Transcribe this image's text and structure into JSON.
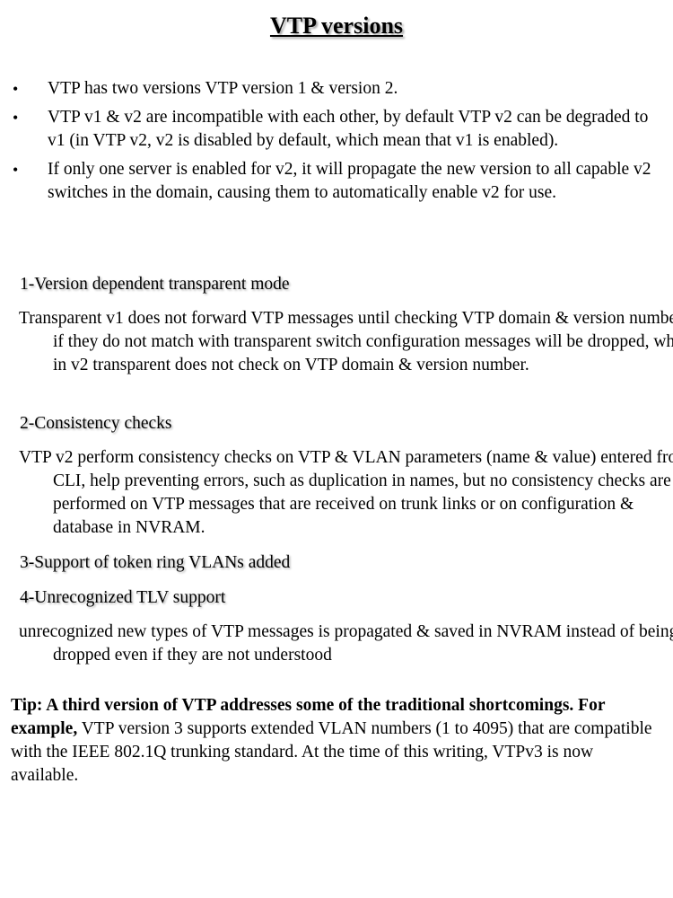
{
  "title": "VTP versions",
  "bullets": [
    "VTP has two versions VTP version 1 & version 2.",
    "VTP v1 & v2 are incompatible with each other, by default VTP v2 can be degraded to v1 (in VTP v2, v2 is disabled by default, which mean that v1 is enabled).",
    "If only one server is enabled for v2, it will propagate the new version to all capable v2 switches in the domain, causing them to automatically enable v2 for use."
  ],
  "bullet_glyph": "•",
  "sections": [
    {
      "heading": "1-Version dependent transparent mode",
      "body": "Transparent v1 does not forward VTP messages until checking VTP domain & version number, if they do not match with transparent switch configuration messages will be dropped, while in v2 transparent does not check on VTP domain & version number."
    },
    {
      "heading": "2-Consistency checks",
      "body": "VTP v2 perform consistency checks on VTP & VLAN parameters (name & value) entered from CLI, help preventing errors, such as duplication in names, but no consistency checks are performed on VTP messages that are received on trunk links or on configuration & database in NVRAM."
    },
    {
      "heading": "3-Support of token ring VLANs added"
    },
    {
      "heading": "4-Unrecognized TLV support",
      "body": "unrecognized new types of VTP messages is propagated & saved in NVRAM instead of being dropped even if they are not understood"
    }
  ],
  "tip": {
    "bold_lead": "Tip: A third version of VTP addresses some of the traditional shortcomings. For example,",
    "text": " VTP version 3 supports extended VLAN numbers (1 to 4095) that are compatible with the IEEE 802.1Q trunking standard. At the time of this writing, VTPv3 is now available."
  }
}
